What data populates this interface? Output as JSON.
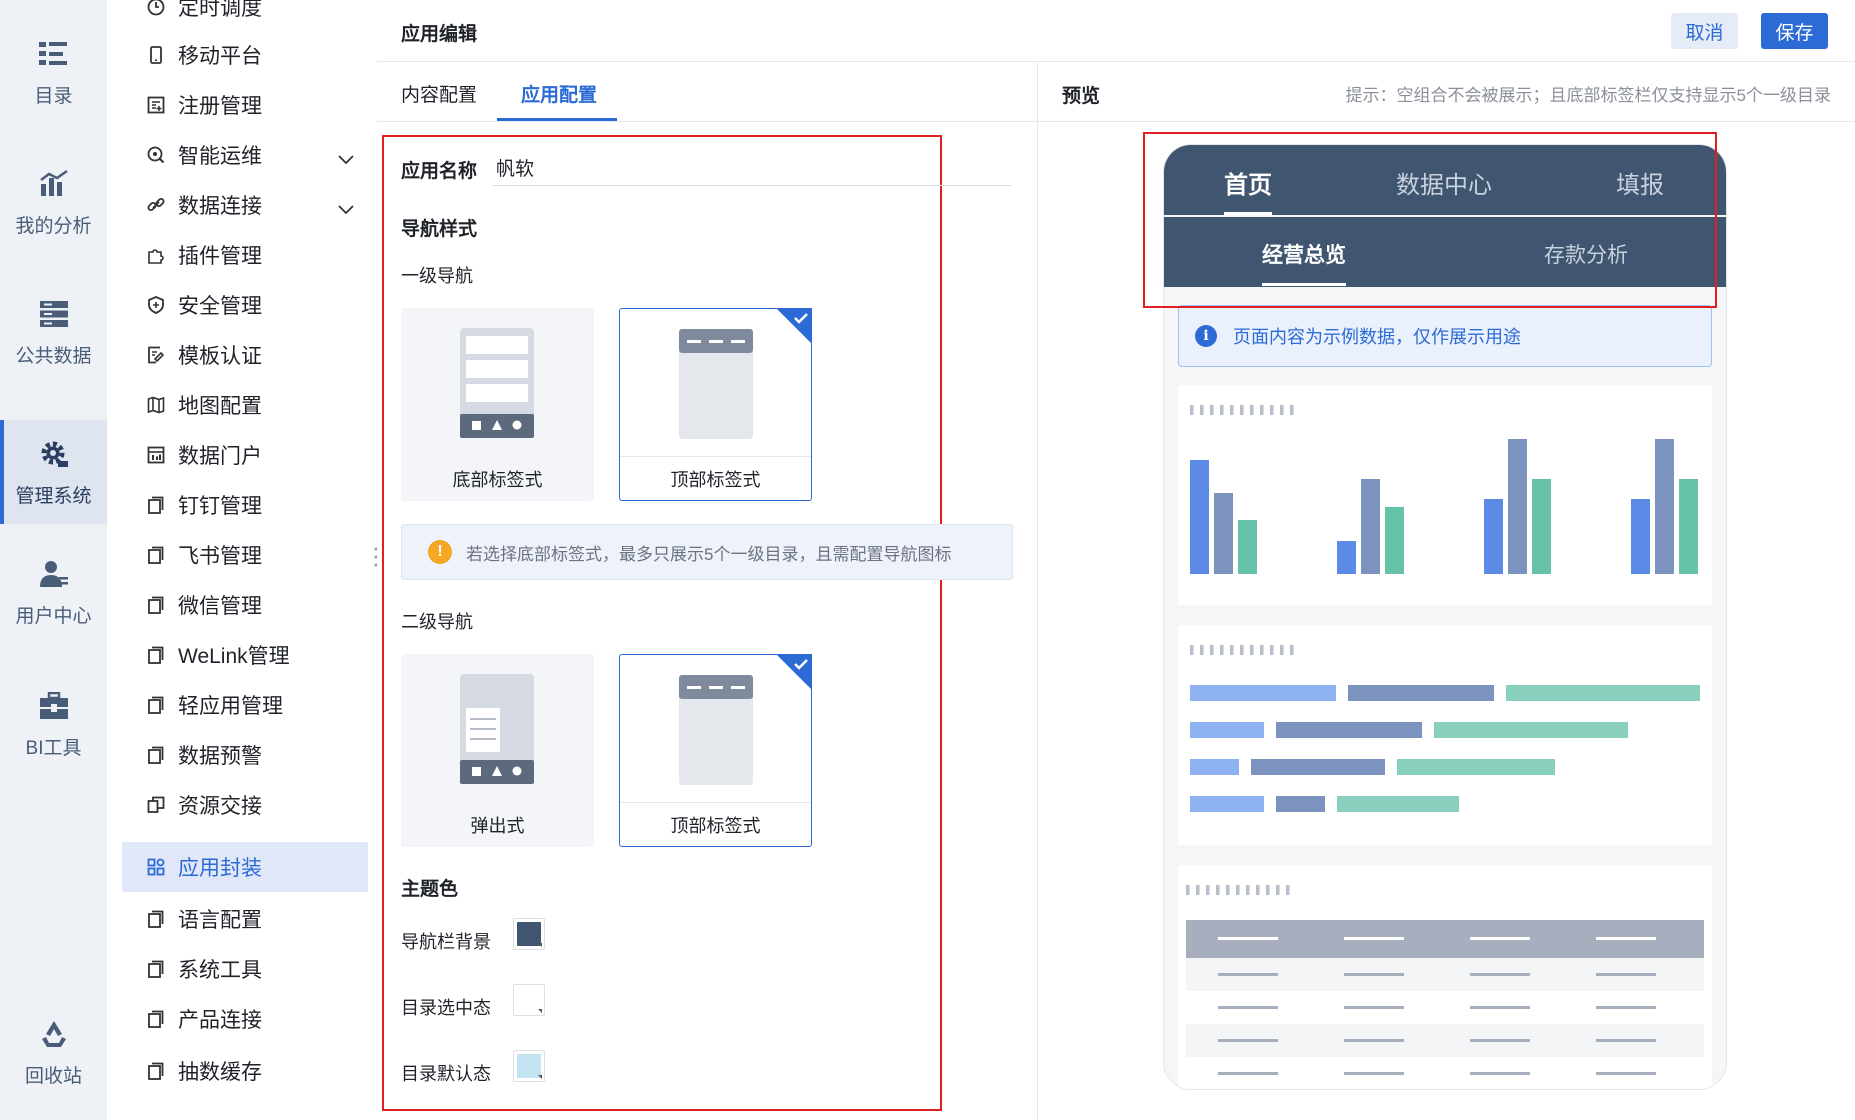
{
  "rail": {
    "items": [
      {
        "label": "目录",
        "icon": "catalog-icon"
      },
      {
        "label": "我的分析",
        "icon": "analysis-icon"
      },
      {
        "label": "公共数据",
        "icon": "database-icon"
      },
      {
        "label": "管理系统",
        "icon": "gear-icon",
        "active": true
      },
      {
        "label": "用户中心",
        "icon": "user-icon"
      },
      {
        "label": "BI工具",
        "icon": "toolbox-icon"
      },
      {
        "label": "回收站",
        "icon": "recycle-icon"
      }
    ]
  },
  "menu": {
    "items": [
      {
        "label": "定时调度",
        "icon": "clock-icon"
      },
      {
        "label": "移动平台",
        "icon": "mobile-icon"
      },
      {
        "label": "注册管理",
        "icon": "register-icon"
      },
      {
        "label": "智能运维",
        "icon": "ops-icon",
        "expandable": true
      },
      {
        "label": "数据连接",
        "icon": "link-icon",
        "expandable": true
      },
      {
        "label": "插件管理",
        "icon": "puzzle-icon"
      },
      {
        "label": "安全管理",
        "icon": "shield-icon"
      },
      {
        "label": "模板认证",
        "icon": "certificate-icon"
      },
      {
        "label": "地图配置",
        "icon": "map-icon"
      },
      {
        "label": "数据门户",
        "icon": "portal-icon"
      },
      {
        "label": "钉钉管理",
        "icon": "page-icon"
      },
      {
        "label": "飞书管理",
        "icon": "page-icon"
      },
      {
        "label": "微信管理",
        "icon": "page-icon"
      },
      {
        "label": "WeLink管理",
        "icon": "page-icon"
      },
      {
        "label": "轻应用管理",
        "icon": "page-icon"
      },
      {
        "label": "数据预警",
        "icon": "page-icon"
      },
      {
        "label": "资源交接",
        "icon": "handover-icon"
      },
      {
        "label": "应用封装",
        "icon": "grid-icon",
        "selected": true
      },
      {
        "label": "语言配置",
        "icon": "page-icon"
      },
      {
        "label": "系统工具",
        "icon": "page-icon"
      },
      {
        "label": "产品连接",
        "icon": "page-icon"
      },
      {
        "label": "抽数缓存",
        "icon": "page-icon"
      }
    ]
  },
  "header": {
    "title": "应用编辑",
    "cancel_label": "取消",
    "save_label": "保存"
  },
  "tabs": {
    "content": "内容配置",
    "app": "应用配置"
  },
  "form": {
    "app_name_label": "应用名称",
    "app_name_value": "帆软",
    "nav_style_title": "导航样式",
    "level1_label": "一级导航",
    "level1_options": [
      {
        "label": "底部标签式",
        "selected": false
      },
      {
        "label": "顶部标签式",
        "selected": true
      }
    ],
    "notice": "若选择底部标签式，最多只展示5个一级目录，且需配置导航图标",
    "level2_label": "二级导航",
    "level2_options": [
      {
        "label": "弹出式",
        "selected": false
      },
      {
        "label": "顶部标签式",
        "selected": true
      }
    ],
    "theme_title": "主题色",
    "theme_items": [
      {
        "label": "导航栏背景",
        "color": "#3f5570"
      },
      {
        "label": "目录选中态",
        "color": "#ffffff"
      },
      {
        "label": "目录默认态",
        "color": "#c3e3f0"
      }
    ]
  },
  "preview": {
    "title": "预览",
    "hint": "提示：空组合不会被展示；且底部标签栏仅支持显示5个一级目录",
    "nav1": [
      "首页",
      "数据中心",
      "填报"
    ],
    "nav2": [
      "经营总览",
      "存款分析"
    ],
    "info": "页面内容为示例数据，仅作展示用途",
    "colors": {
      "blue": "#5b8be6",
      "slate": "#7c93bf",
      "teal": "#66c2a8",
      "header_gray": "#a7afbf"
    }
  }
}
